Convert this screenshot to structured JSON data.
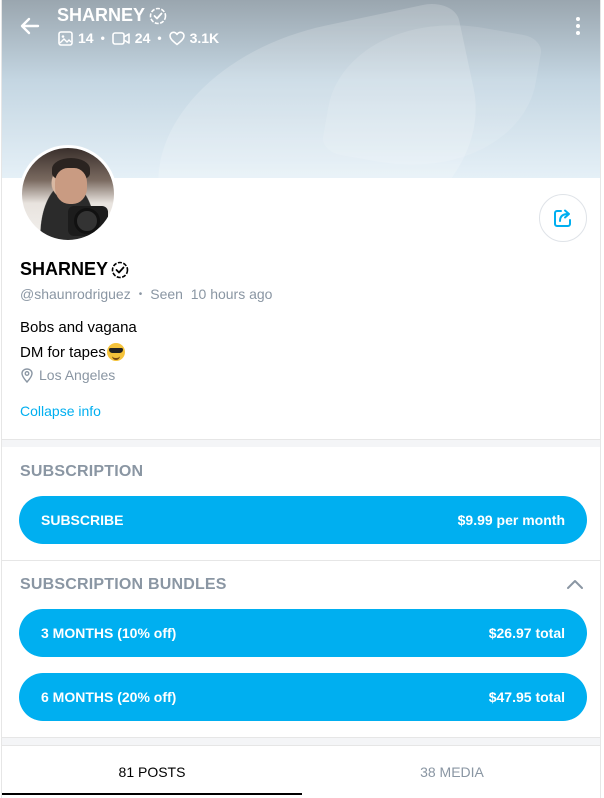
{
  "header": {
    "title": "SHARNEY",
    "stats": [
      {
        "icon": "image-icon",
        "value": "14"
      },
      {
        "icon": "video-icon",
        "value": "24"
      },
      {
        "icon": "heart-icon",
        "value": "3.1K"
      }
    ]
  },
  "profile": {
    "name": "SHARNEY",
    "handle": "@shaunrodriguez",
    "last_seen": "Seen  10 hours ago",
    "bio_line1": "Bobs and vagana",
    "bio_line2": "DM for tapes",
    "location": "Los Angeles",
    "collapse_label": "Collapse info"
  },
  "subscription": {
    "title": "SUBSCRIPTION",
    "button_label": "SUBSCRIBE",
    "price": "$9.99 per month"
  },
  "bundles": {
    "title": "SUBSCRIPTION BUNDLES",
    "items": [
      {
        "label": "3 MONTHS (10% off)",
        "price": "$26.97 total"
      },
      {
        "label": "6 MONTHS (20% off)",
        "price": "$47.95 total"
      }
    ]
  },
  "tabs": [
    {
      "label": "81 POSTS",
      "active": true
    },
    {
      "label": "38 MEDIA",
      "active": false
    }
  ],
  "colors": {
    "accent": "#00aff0",
    "muted_text": "#8a96a3"
  }
}
